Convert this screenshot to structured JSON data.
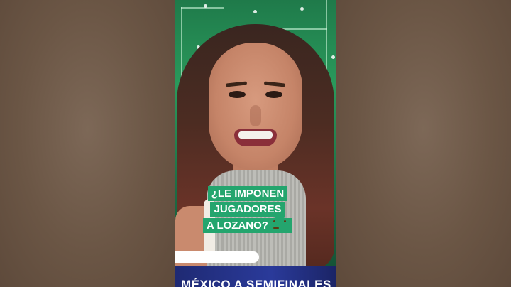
{
  "caption": {
    "line1": "¿LE IMPONEN JUGADORES",
    "line2": "A LOZANO?",
    "emoji": "slightly-smiling-face-icon"
  },
  "banner": {
    "text": "MÉXICO A SEMIFINALES"
  },
  "colors": {
    "caption_bg": "#24a56e",
    "banner_bg": "#2a3a9a",
    "studio_green": "#2a9a5c"
  }
}
